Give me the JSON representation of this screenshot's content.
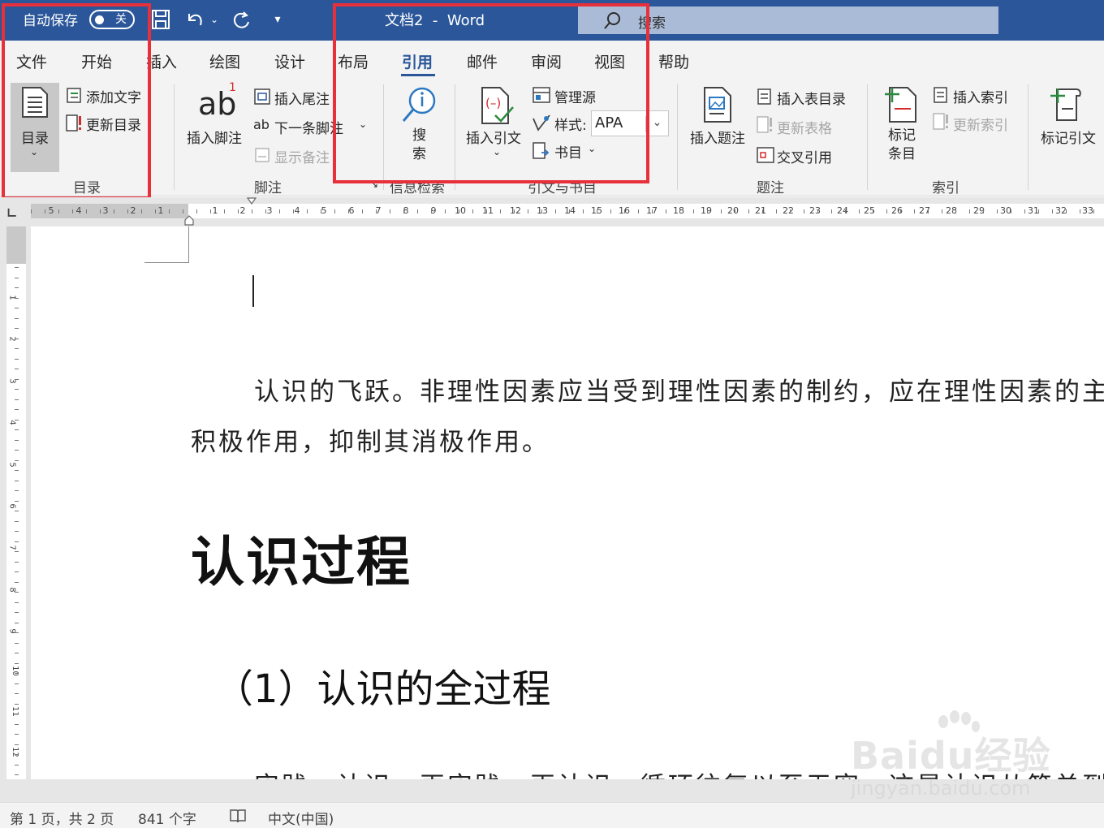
{
  "titlebar": {
    "autosave_label": "自动保存",
    "autosave_state": "关",
    "doc_title": "文档2  -  Word",
    "search_placeholder": "搜索"
  },
  "tabs": [
    "文件",
    "开始",
    "插入",
    "绘图",
    "设计",
    "布局",
    "引用",
    "邮件",
    "审阅",
    "视图",
    "帮助"
  ],
  "active_tab": "引用",
  "ribbon": {
    "toc": {
      "button": "目录",
      "add_text": "添加文字",
      "update_toc": "更新目录",
      "group": "目录"
    },
    "footnotes": {
      "insert_footnote": "插入脚注",
      "insert_endnote": "插入尾注",
      "next_footnote": "下一条脚注",
      "show_notes": "显示备注",
      "group": "脚注"
    },
    "research": {
      "search": "搜索",
      "group": "信息检索"
    },
    "citations": {
      "insert_citation": "插入引文",
      "manage_sources": "管理源",
      "style_label": "样式:",
      "style_value": "APA",
      "bibliography": "书目",
      "group": "引文与书目"
    },
    "captions": {
      "insert_caption": "插入题注",
      "insert_table_of_figures": "插入表目录",
      "update_table": "更新表格",
      "cross_reference": "交叉引用",
      "group": "题注"
    },
    "index": {
      "mark_entry": "标记条目",
      "insert_index": "插入索引",
      "update_index": "更新索引",
      "group": "索引"
    },
    "toa": {
      "mark_citation": "标记引文"
    }
  },
  "ruler": {
    "left_numbers": [
      "5",
      "4",
      "3",
      "2",
      "1"
    ],
    "right_numbers": [
      "1",
      "2",
      "3",
      "4",
      "5",
      "6",
      "7",
      "8",
      "9",
      "10",
      "11",
      "12",
      "13",
      "14",
      "15",
      "16",
      "17",
      "18",
      "19",
      "20",
      "21",
      "22",
      "23",
      "24",
      "25",
      "26",
      "27",
      "28",
      "29",
      "30",
      "31",
      "32",
      "33"
    ],
    "vertical_numbers": [
      "1",
      "2",
      "3",
      "4",
      "5",
      "6",
      "7",
      "8",
      "9",
      "10",
      "11",
      "12",
      "13"
    ]
  },
  "document": {
    "para1_line1": "认识的飞跃。非理性因素应当受到理性因素的制约，应在理性因素的主导",
    "para1_line2": "积极作用，抑制其消极作用。",
    "heading1": "认识过程",
    "heading2": "（1）认识的全过程",
    "para2_line1": "实践、认识、再实践、再认识，循环往复以至无穷，这是认识从简单到复"
  },
  "watermark": {
    "brand": "Baidu经验",
    "url": "jingyan.baidu.com"
  },
  "statusbar": {
    "page_info": "第 1 页，共 2 页",
    "word_count": "841 个字",
    "language": "中文(中国)"
  },
  "colors": {
    "title_blue": "#2b579a",
    "highlight_red": "#e8303a",
    "ribbon_bg": "#f3f3f3"
  }
}
